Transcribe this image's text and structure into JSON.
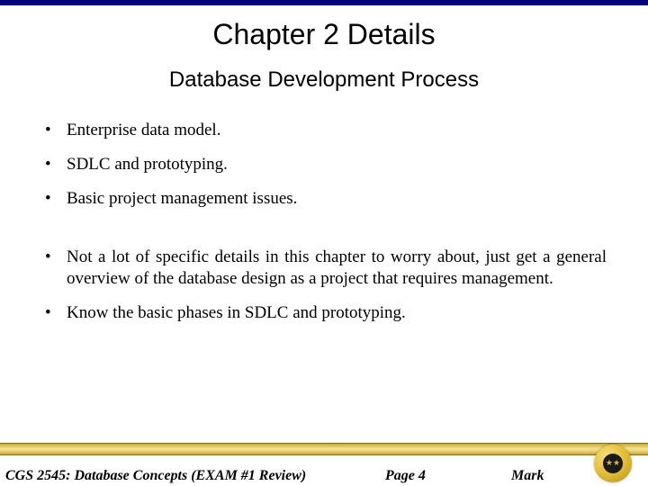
{
  "title": "Chapter 2 Details",
  "subtitle": "Database Development Process",
  "bullets_a": [
    "Enterprise data model.",
    "SDLC and prototyping.",
    "Basic project management issues."
  ],
  "bullets_b": [
    "Not a lot of specific details in this chapter to worry about, just get a general overview of the database design as a project that requires management.",
    "Know the basic phases in SDLC and prototyping."
  ],
  "footer": {
    "course": "CGS 2545: Database Concepts  (EXAM #1 Review)",
    "page": "Page 4",
    "author": "Mark"
  }
}
